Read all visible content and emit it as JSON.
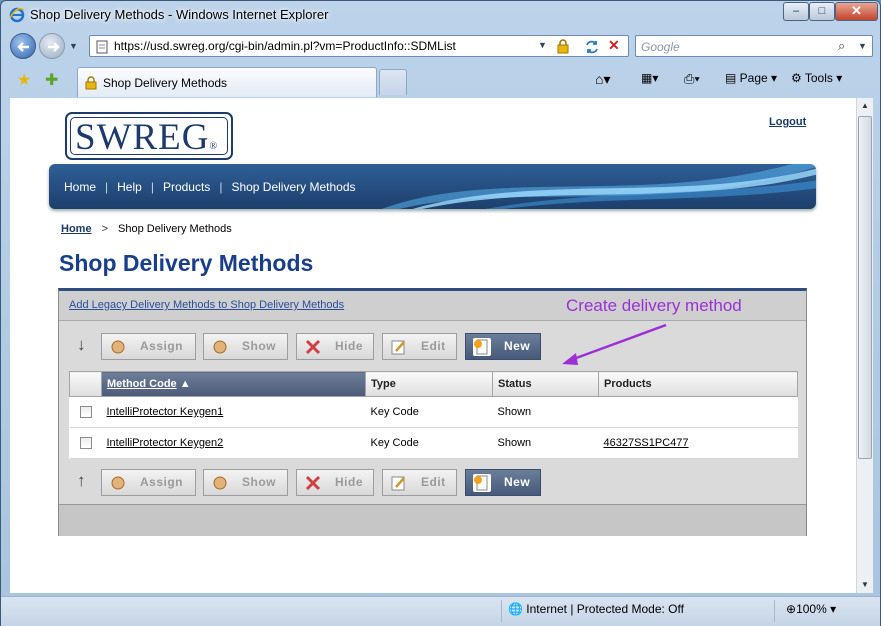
{
  "window": {
    "title": "Shop Delivery Methods - Windows Internet Explorer",
    "min_label": "–",
    "max_label": "□",
    "close_label": "✕"
  },
  "address": {
    "url": "https://usd.swreg.org/cgi-bin/admin.pl?vm=ProductInfo::SDMList",
    "search_placeholder": "Google"
  },
  "tabs": [
    {
      "label": "Shop Delivery Methods"
    }
  ],
  "command_bar": {
    "page_label": "Page",
    "tools_label": "Tools"
  },
  "status": {
    "zone": "Internet | Protected Mode: Off",
    "zoom": "100%"
  },
  "page": {
    "logo_text": "SWREG",
    "logo_mark": "®",
    "logout_label": "Logout",
    "nav": [
      "Home",
      "Help",
      "Products",
      "Shop Delivery Methods"
    ],
    "breadcrumb": {
      "home": "Home",
      "sep": ">",
      "current": "Shop Delivery Methods"
    },
    "title": "Shop Delivery Methods",
    "legacy_link": "Add Legacy Delivery Methods to Shop Delivery Methods",
    "annotation": "Create delivery method",
    "buttons": {
      "assign": "Assign",
      "show": "Show",
      "hide": "Hide",
      "edit": "Edit",
      "new": "New"
    },
    "table": {
      "columns": [
        "Method Code",
        "Type",
        "Status",
        "Products"
      ],
      "sort_indicator": "▲",
      "rows": [
        {
          "method": "IntelliProtector Keygen1",
          "type": "Key Code",
          "status": "Shown",
          "products": ""
        },
        {
          "method": "IntelliProtector Keygen2",
          "type": "Key Code",
          "status": "Shown",
          "products": "46327SS1PC477"
        }
      ]
    }
  },
  "colors": {
    "banner": "#1d3f6c",
    "title": "#1a3f8a",
    "annotation": "#9b30d6"
  }
}
